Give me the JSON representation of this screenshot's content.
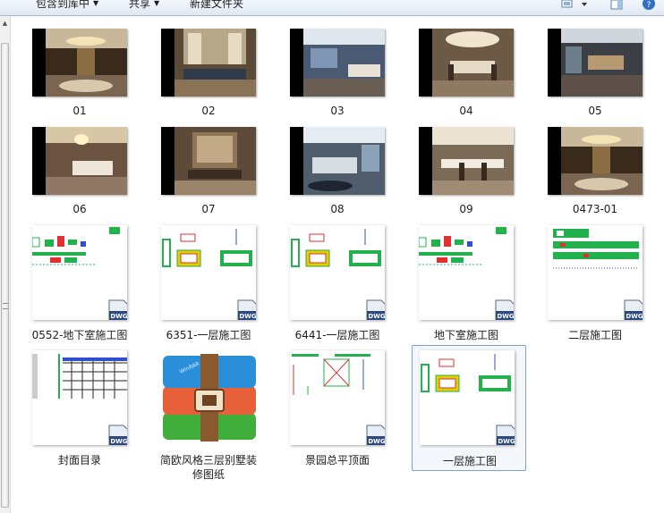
{
  "toolbar": {
    "include_in_library": "包含到库中",
    "share": "共享",
    "new_folder": "新建文件夹"
  },
  "items": [
    {
      "label": "01",
      "kind": "photo",
      "scene": "lobby"
    },
    {
      "label": "02",
      "kind": "photo",
      "scene": "living"
    },
    {
      "label": "03",
      "kind": "photo",
      "scene": "living2"
    },
    {
      "label": "04",
      "kind": "photo",
      "scene": "dining"
    },
    {
      "label": "05",
      "kind": "photo",
      "scene": "bar"
    },
    {
      "label": "06",
      "kind": "photo",
      "scene": "bedroom"
    },
    {
      "label": "07",
      "kind": "photo",
      "scene": "study"
    },
    {
      "label": "08",
      "kind": "photo",
      "scene": "bedroom2"
    },
    {
      "label": "09",
      "kind": "photo",
      "scene": "dining2"
    },
    {
      "label": "0473-01",
      "kind": "photo",
      "scene": "lobby2"
    },
    {
      "label": "0552-地下室施工图",
      "kind": "dwg"
    },
    {
      "label": "6351-一层施工图",
      "kind": "dwg"
    },
    {
      "label": "6441-一层施工图",
      "kind": "dwg"
    },
    {
      "label": "地下室施工图",
      "kind": "dwg"
    },
    {
      "label": "二层施工图",
      "kind": "dwg"
    },
    {
      "label": "封面目录",
      "kind": "dwg"
    },
    {
      "label": "简欧风格三层别墅装修图纸",
      "label_line1": "简欧风格三层别墅装",
      "label_line2": "修图纸",
      "kind": "archive"
    },
    {
      "label": "景园总平顶面",
      "kind": "dwg"
    },
    {
      "label": "一层施工图",
      "kind": "dwg",
      "selected": true
    }
  ],
  "badge_text": "DWG",
  "colors": {
    "toolbar_top": "#f3f7fc",
    "selection_border": "#7da2ce",
    "dwg_green": "#22b14c",
    "dwg_red": "#e03030",
    "dwg_blue": "#3050d0"
  }
}
